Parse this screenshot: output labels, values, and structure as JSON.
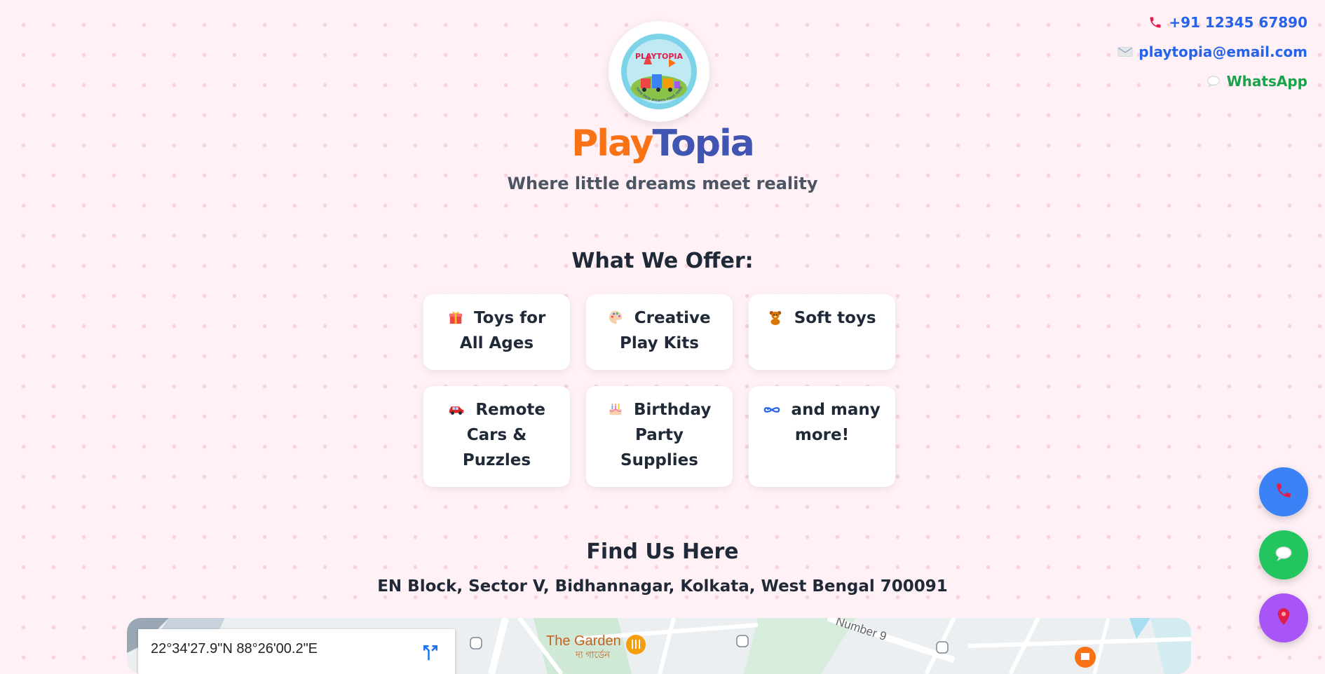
{
  "contact": {
    "phone": "+91 12345 67890",
    "email": "playtopia@email.com",
    "whatsapp": "WhatsApp"
  },
  "logo": {
    "name": "PLAYTOPIA",
    "tagline": "Where little dreams meet reality"
  },
  "brand": {
    "part1": "Play",
    "part2": "Topia",
    "tagline": "Where little dreams meet reality"
  },
  "offers": {
    "title": "What We Offer:",
    "items": [
      {
        "icon": "gift-icon",
        "label": "Toys for All Ages"
      },
      {
        "icon": "palette-icon",
        "label": "Creative Play Kits"
      },
      {
        "icon": "teddy-bear-icon",
        "label": "Soft toys"
      },
      {
        "icon": "car-icon",
        "label": "Remote Cars & Puzzles"
      },
      {
        "icon": "cake-icon",
        "label": "Birthday Party Supplies"
      },
      {
        "icon": "infinity-icon",
        "label": "and many more!"
      }
    ]
  },
  "location": {
    "title": "Find Us Here",
    "address": "EN Block, Sector V, Bidhannagar, Kolkata, West Bengal 700091"
  },
  "map": {
    "coordinates": "22°34'27.9\"N 88°26'00.2\"E",
    "place_name": "The Garden",
    "place_name_local": "দ্য গার্ডেন",
    "street": "Number 9"
  },
  "fabs": {
    "call": "call-icon",
    "chat": "chat-icon",
    "location": "location-pin-icon"
  },
  "colors": {
    "background": "#fff1f5",
    "brand_orange": "#f97316",
    "brand_blue": "#4054b2",
    "link_blue": "#2563eb",
    "whatsapp_green": "#16a34a",
    "fab_call": "#3b82f6",
    "fab_chat": "#22c55e",
    "fab_map": "#a855f7"
  }
}
